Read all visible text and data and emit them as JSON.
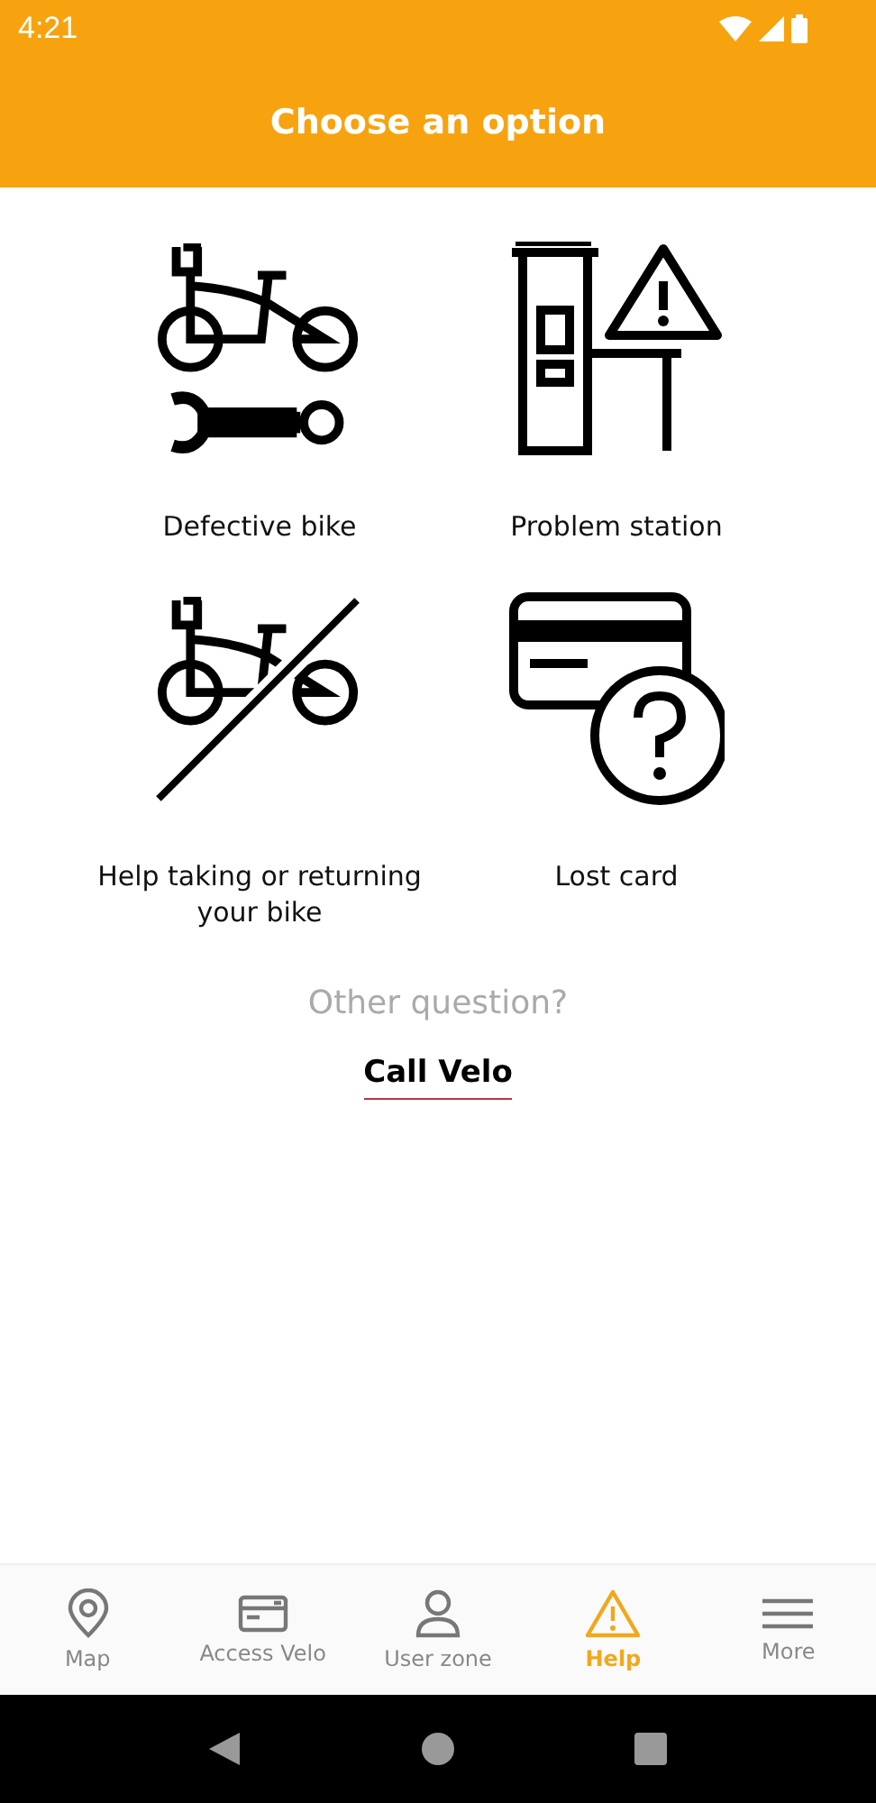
{
  "status_bar": {
    "time": "4:21"
  },
  "header": {
    "title": "Choose an option"
  },
  "options": [
    {
      "kind": "bike-repair",
      "label": "Defective bike"
    },
    {
      "kind": "station",
      "label": "Problem station"
    },
    {
      "kind": "no-bike",
      "label": "Help taking or returning your bike"
    },
    {
      "kind": "card",
      "label": "Lost card"
    }
  ],
  "other": {
    "question": "Other question?",
    "link": "Call Velo"
  },
  "bottom_nav": [
    {
      "kind": "map",
      "label": "Map",
      "selected": false
    },
    {
      "kind": "card",
      "label": "Access Velo",
      "selected": false
    },
    {
      "kind": "user",
      "label": "User zone",
      "selected": false
    },
    {
      "kind": "help",
      "label": "Help",
      "selected": true
    },
    {
      "kind": "more",
      "label": "More",
      "selected": false
    }
  ]
}
